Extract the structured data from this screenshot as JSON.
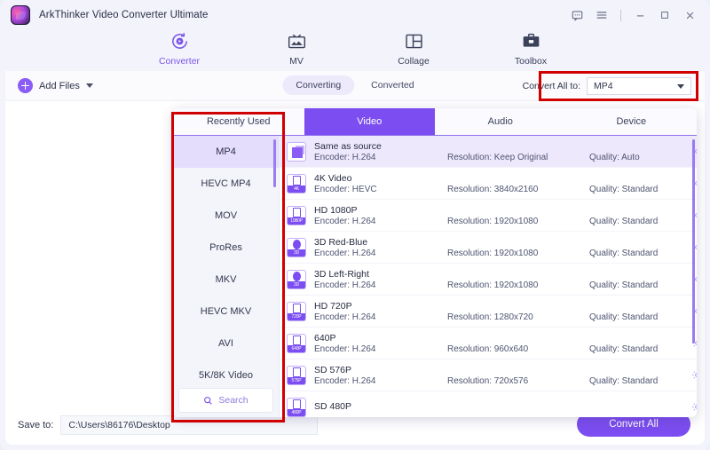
{
  "window": {
    "app_title": "ArkThinker Video Converter Ultimate",
    "controls": [
      {
        "name": "feedback-icon",
        "label": "feedback"
      },
      {
        "name": "menu-icon",
        "label": "menu"
      },
      {
        "name": "minimize-icon",
        "label": "minimize"
      },
      {
        "name": "maximize-icon",
        "label": "maximize"
      },
      {
        "name": "close-icon",
        "label": "close"
      }
    ]
  },
  "nav": {
    "items": [
      {
        "label": "Converter",
        "icon": "converter-icon",
        "active": true
      },
      {
        "label": "MV",
        "icon": "mv-icon",
        "active": false
      },
      {
        "label": "Collage",
        "icon": "collage-icon",
        "active": false
      },
      {
        "label": "Toolbox",
        "icon": "toolbox-icon",
        "active": false
      }
    ]
  },
  "toolbar": {
    "add_files_label": "Add Files",
    "segments": [
      {
        "label": "Converting",
        "active": true
      },
      {
        "label": "Converted",
        "active": false
      }
    ],
    "convert_all_label": "Convert All to:",
    "convert_all_value": "MP4"
  },
  "save_bar": {
    "save_to_label": "Save to:",
    "save_to_value": "C:\\Users\\86176\\Desktop",
    "convert_button_label": "Convert All"
  },
  "format_panel": {
    "tabs": [
      {
        "label": "Recently Used",
        "active": false
      },
      {
        "label": "Video",
        "active": true
      },
      {
        "label": "Audio",
        "active": false
      },
      {
        "label": "Device",
        "active": false
      }
    ],
    "sidebar_formats": [
      {
        "label": "MP4",
        "active": true
      },
      {
        "label": "HEVC MP4",
        "active": false
      },
      {
        "label": "MOV",
        "active": false
      },
      {
        "label": "ProRes",
        "active": false
      },
      {
        "label": "MKV",
        "active": false
      },
      {
        "label": "HEVC MKV",
        "active": false
      },
      {
        "label": "AVI",
        "active": false
      },
      {
        "label": "5K/8K Video",
        "active": false
      }
    ],
    "search_placeholder": "Search",
    "presets": [
      {
        "title": "Same as source",
        "encoder": "Encoder: H.264",
        "resolution": "Resolution: Keep Original",
        "quality": "Quality: Auto",
        "badge": "",
        "icon_style": "src",
        "selected": true
      },
      {
        "title": "4K Video",
        "encoder": "Encoder: HEVC",
        "resolution": "Resolution: 3840x2160",
        "quality": "Quality: Standard",
        "badge": "4K",
        "icon_style": "badge",
        "selected": false
      },
      {
        "title": "HD 1080P",
        "encoder": "Encoder: H.264",
        "resolution": "Resolution: 1920x1080",
        "quality": "Quality: Standard",
        "badge": "1080P",
        "icon_style": "badge",
        "selected": false
      },
      {
        "title": "3D Red-Blue",
        "encoder": "Encoder: H.264",
        "resolution": "Resolution: 1920x1080",
        "quality": "Quality: Standard",
        "badge": "3D",
        "icon_style": "badge",
        "selected": false
      },
      {
        "title": "3D Left-Right",
        "encoder": "Encoder: H.264",
        "resolution": "Resolution: 1920x1080",
        "quality": "Quality: Standard",
        "badge": "3D",
        "icon_style": "badge",
        "selected": false
      },
      {
        "title": "HD 720P",
        "encoder": "Encoder: H.264",
        "resolution": "Resolution: 1280x720",
        "quality": "Quality: Standard",
        "badge": "720P",
        "icon_style": "badge",
        "selected": false
      },
      {
        "title": "640P",
        "encoder": "Encoder: H.264",
        "resolution": "Resolution: 960x640",
        "quality": "Quality: Standard",
        "badge": "640P",
        "icon_style": "badge",
        "selected": false
      },
      {
        "title": "SD 576P",
        "encoder": "Encoder: H.264",
        "resolution": "Resolution: 720x576",
        "quality": "Quality: Standard",
        "badge": "576P",
        "icon_style": "badge",
        "selected": false
      },
      {
        "title": "SD 480P",
        "encoder": "",
        "resolution": "",
        "quality": "",
        "badge": "480P",
        "icon_style": "badge",
        "selected": false
      }
    ]
  },
  "colors": {
    "accent": "#7c4df0",
    "accent_light": "#eee8fd",
    "highlight_box": "#d00000",
    "window_bg": "#f2f3fb"
  }
}
